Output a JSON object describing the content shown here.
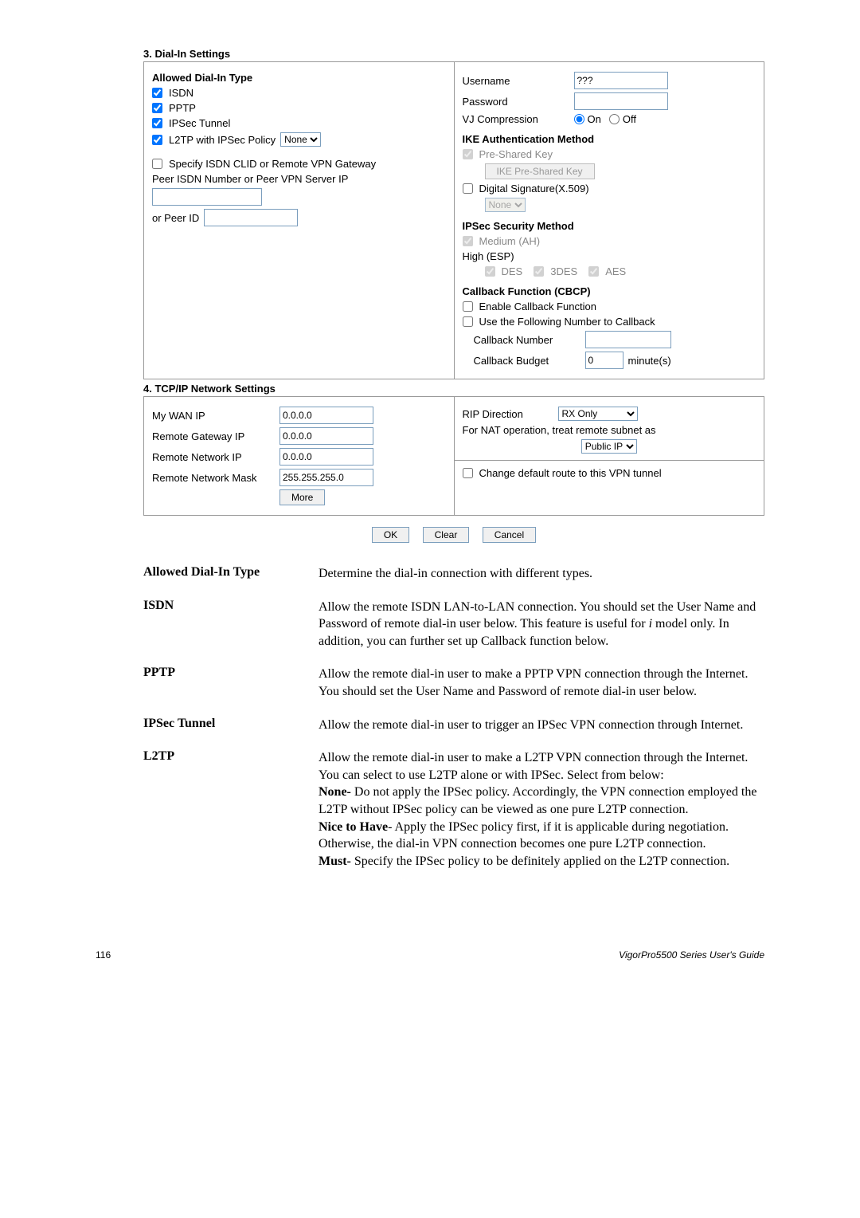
{
  "section3": {
    "title": "3. Dial-In Settings",
    "allowed_title": "Allowed Dial-In Type",
    "isdn": "ISDN",
    "pptp": "PPTP",
    "ipsec_tunnel": "IPSec Tunnel",
    "l2tp_label": "L2TP with IPSec Policy",
    "l2tp_select": "None",
    "specify_clid": "Specify ISDN CLID or Remote VPN Gateway",
    "peer_ip_label": "Peer ISDN Number or Peer VPN Server IP",
    "peer_input": "",
    "or_peer_id": "or Peer ID",
    "peer_id_input": "",
    "username_label": "Username",
    "username_value": "???",
    "password_label": "Password",
    "password_value": "",
    "vj_label": "VJ Compression",
    "vj_on": "On",
    "vj_off": "Off",
    "ike_auth_title": "IKE Authentication Method",
    "preshared": "Pre-Shared Key",
    "ike_key_btn": "IKE Pre-Shared Key",
    "digital_sig": "Digital Signature(X.509)",
    "none_select": "None",
    "ipsec_sec_title": "IPSec Security Method",
    "medium": "Medium (AH)",
    "high": "High (ESP)",
    "des": "DES",
    "des3": "3DES",
    "aes": "AES",
    "callback_title": "Callback Function (CBCP)",
    "enable_callback": "Enable Callback Function",
    "use_following": "Use the Following Number to Callback",
    "callback_number": "Callback Number",
    "callback_number_val": "",
    "callback_budget": "Callback Budget",
    "callback_budget_val": "0",
    "minutes": "minute(s)"
  },
  "section4": {
    "title": "4. TCP/IP Network Settings",
    "my_wan_ip": "My WAN IP",
    "my_wan_ip_val": "0.0.0.0",
    "remote_gw": "Remote Gateway IP",
    "remote_gw_val": "0.0.0.0",
    "remote_net": "Remote Network IP",
    "remote_net_val": "0.0.0.0",
    "remote_mask": "Remote Network Mask",
    "remote_mask_val": "255.255.255.0",
    "more_btn": "More",
    "rip_dir": "RIP Direction",
    "rip_val": "RX Only",
    "nat_text": "For NAT operation, treat remote subnet as",
    "nat_val": "Public IP",
    "change_route": "Change default route to this VPN tunnel"
  },
  "buttons": {
    "ok": "OK",
    "clear": "Clear",
    "cancel": "Cancel"
  },
  "desc": {
    "allowed": {
      "label": "Allowed Dial-In Type",
      "text": "Determine the dial-in connection with different types."
    },
    "isdn": {
      "label": "ISDN",
      "text_a": "Allow the remote ISDN LAN-to-LAN connection. You should set the User Name and Password of remote dial-in user below. This feature is useful for ",
      "text_i": "i",
      "text_b": " model only. In addition, you can further set up Callback function below."
    },
    "pptp": {
      "label": "PPTP",
      "text": "Allow the remote dial-in user to make a PPTP VPN connection through the Internet. You should set the User Name and Password of remote dial-in user below."
    },
    "ipsec": {
      "label": "IPSec Tunnel",
      "text": "Allow the remote dial-in user to trigger an IPSec VPN connection through Internet."
    },
    "l2tp": {
      "label": "L2TP",
      "t1": "Allow the remote dial-in user to make a L2TP VPN connection through the Internet. You can select to use L2TP alone or with IPSec. Select from below:",
      "t2a": "None-",
      "t2b": " Do not apply the IPSec policy. Accordingly, the VPN connection employed the L2TP without IPSec policy can be viewed as one pure L2TP connection.",
      "t3a": "Nice to Have",
      "t3b": "- Apply the IPSec policy first, if it is applicable during negotiation. Otherwise, the dial-in VPN connection becomes one pure L2TP connection.",
      "t4a": "Must-",
      "t4b": " Specify the IPSec policy to be definitely applied on the L2TP connection."
    }
  },
  "footer": {
    "page": "116",
    "guide": "VigorPro5500  Series  User's  Guide"
  }
}
